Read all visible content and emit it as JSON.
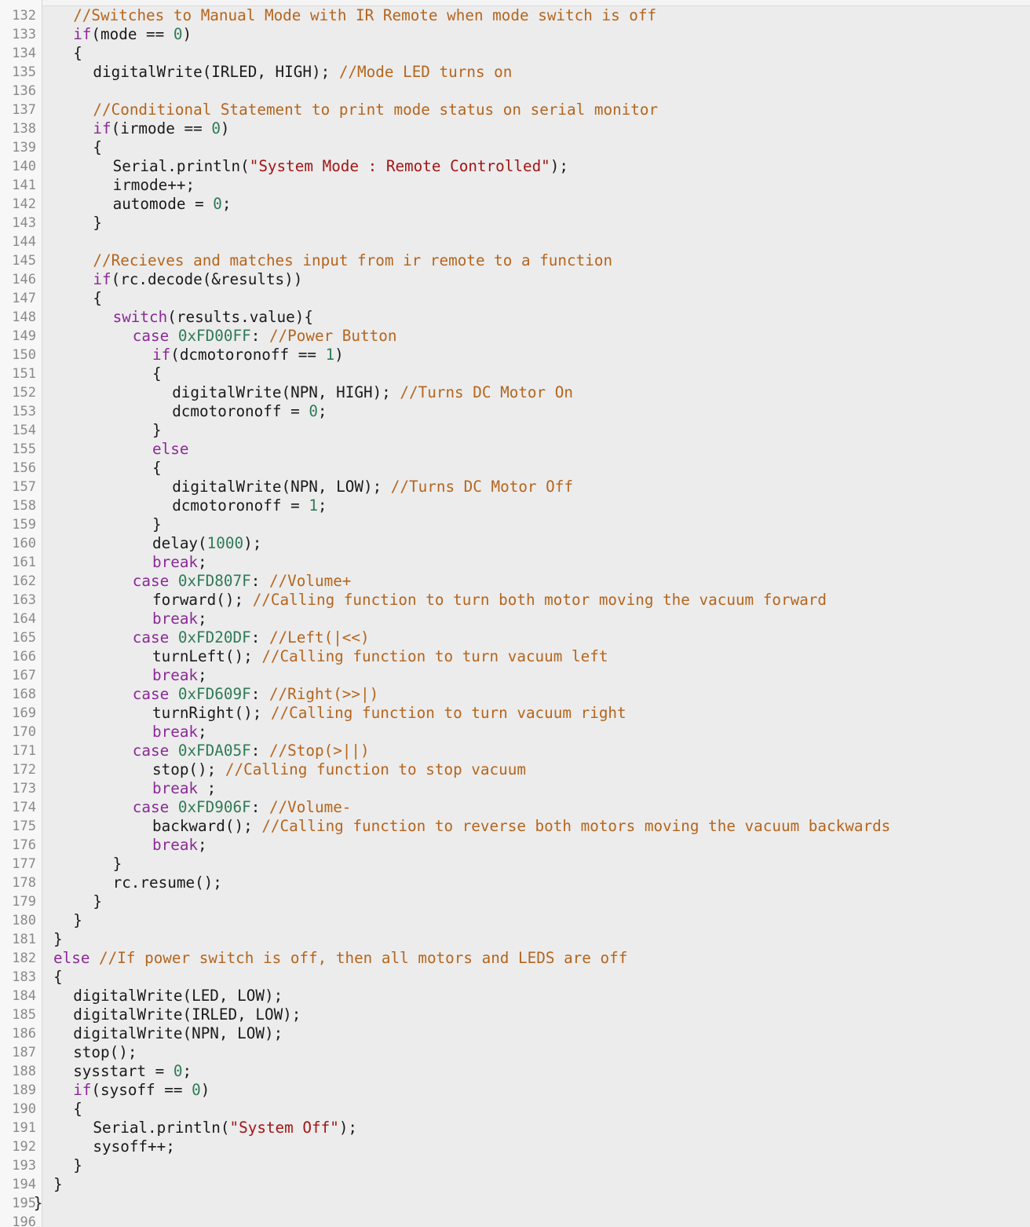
{
  "colors": {
    "background": "#ececec",
    "gutter": "#f7f7f7",
    "line_number": "#8a8a8a",
    "text": "#1a1a1a",
    "keyword": "#8a2a96",
    "comment": "#b5651d",
    "string": "#a31515",
    "number": "#2f7a56"
  },
  "lines": [
    {
      "n": "132",
      "indent": 2,
      "tokens": [
        {
          "t": "cm",
          "v": "//Switches to Manual Mode with IR Remote when mode switch is off"
        }
      ]
    },
    {
      "n": "133",
      "indent": 2,
      "tokens": [
        {
          "t": "kw",
          "v": "if"
        },
        {
          "t": "tx",
          "v": "(mode == "
        },
        {
          "t": "nm",
          "v": "0"
        },
        {
          "t": "tx",
          "v": ")"
        }
      ]
    },
    {
      "n": "134",
      "indent": 2,
      "tokens": [
        {
          "t": "tx",
          "v": "{"
        }
      ]
    },
    {
      "n": "135",
      "indent": 3,
      "tokens": [
        {
          "t": "tx",
          "v": "digitalWrite(IRLED, HIGH); "
        },
        {
          "t": "cm",
          "v": "//Mode LED turns on"
        }
      ]
    },
    {
      "n": "136",
      "indent": 0,
      "tokens": []
    },
    {
      "n": "137",
      "indent": 3,
      "tokens": [
        {
          "t": "cm",
          "v": "//Conditional Statement to print mode status on serial monitor"
        }
      ]
    },
    {
      "n": "138",
      "indent": 3,
      "tokens": [
        {
          "t": "kw",
          "v": "if"
        },
        {
          "t": "tx",
          "v": "(irmode == "
        },
        {
          "t": "nm",
          "v": "0"
        },
        {
          "t": "tx",
          "v": ")"
        }
      ]
    },
    {
      "n": "139",
      "indent": 3,
      "tokens": [
        {
          "t": "tx",
          "v": "{"
        }
      ]
    },
    {
      "n": "140",
      "indent": 4,
      "tokens": [
        {
          "t": "tx",
          "v": "Serial.println("
        },
        {
          "t": "st",
          "v": "\"System Mode : Remote Controlled\""
        },
        {
          "t": "tx",
          "v": ");"
        }
      ]
    },
    {
      "n": "141",
      "indent": 4,
      "tokens": [
        {
          "t": "tx",
          "v": "irmode++;"
        }
      ]
    },
    {
      "n": "142",
      "indent": 4,
      "tokens": [
        {
          "t": "tx",
          "v": "automode = "
        },
        {
          "t": "nm",
          "v": "0"
        },
        {
          "t": "tx",
          "v": ";"
        }
      ]
    },
    {
      "n": "143",
      "indent": 3,
      "tokens": [
        {
          "t": "tx",
          "v": "}"
        }
      ]
    },
    {
      "n": "144",
      "indent": 0,
      "tokens": []
    },
    {
      "n": "145",
      "indent": 3,
      "tokens": [
        {
          "t": "cm",
          "v": "//Recieves and matches input from ir remote to a function"
        }
      ]
    },
    {
      "n": "146",
      "indent": 3,
      "tokens": [
        {
          "t": "kw",
          "v": "if"
        },
        {
          "t": "tx",
          "v": "(rc.decode(&results))"
        }
      ]
    },
    {
      "n": "147",
      "indent": 3,
      "tokens": [
        {
          "t": "tx",
          "v": "{"
        }
      ]
    },
    {
      "n": "148",
      "indent": 4,
      "tokens": [
        {
          "t": "kw",
          "v": "switch"
        },
        {
          "t": "tx",
          "v": "(results.value){"
        }
      ]
    },
    {
      "n": "149",
      "indent": 5,
      "tokens": [
        {
          "t": "kw",
          "v": "case"
        },
        {
          "t": "tx",
          "v": " "
        },
        {
          "t": "nm",
          "v": "0xFD00FF"
        },
        {
          "t": "tx",
          "v": ": "
        },
        {
          "t": "cm",
          "v": "//Power Button"
        }
      ]
    },
    {
      "n": "150",
      "indent": 6,
      "tokens": [
        {
          "t": "kw",
          "v": "if"
        },
        {
          "t": "tx",
          "v": "(dcmotoronoff == "
        },
        {
          "t": "nm",
          "v": "1"
        },
        {
          "t": "tx",
          "v": ")"
        }
      ]
    },
    {
      "n": "151",
      "indent": 6,
      "tokens": [
        {
          "t": "tx",
          "v": "{"
        }
      ]
    },
    {
      "n": "152",
      "indent": 7,
      "tokens": [
        {
          "t": "tx",
          "v": "digitalWrite(NPN, HIGH); "
        },
        {
          "t": "cm",
          "v": "//Turns DC Motor On"
        }
      ]
    },
    {
      "n": "153",
      "indent": 7,
      "tokens": [
        {
          "t": "tx",
          "v": "dcmotoronoff = "
        },
        {
          "t": "nm",
          "v": "0"
        },
        {
          "t": "tx",
          "v": ";"
        }
      ]
    },
    {
      "n": "154",
      "indent": 6,
      "tokens": [
        {
          "t": "tx",
          "v": "}"
        }
      ]
    },
    {
      "n": "155",
      "indent": 6,
      "tokens": [
        {
          "t": "kw",
          "v": "else"
        }
      ]
    },
    {
      "n": "156",
      "indent": 6,
      "tokens": [
        {
          "t": "tx",
          "v": "{"
        }
      ]
    },
    {
      "n": "157",
      "indent": 7,
      "tokens": [
        {
          "t": "tx",
          "v": "digitalWrite(NPN, LOW); "
        },
        {
          "t": "cm",
          "v": "//Turns DC Motor Off"
        }
      ]
    },
    {
      "n": "158",
      "indent": 7,
      "tokens": [
        {
          "t": "tx",
          "v": "dcmotoronoff = "
        },
        {
          "t": "nm",
          "v": "1"
        },
        {
          "t": "tx",
          "v": ";"
        }
      ]
    },
    {
      "n": "159",
      "indent": 6,
      "tokens": [
        {
          "t": "tx",
          "v": "}"
        }
      ]
    },
    {
      "n": "160",
      "indent": 6,
      "tokens": [
        {
          "t": "tx",
          "v": "delay("
        },
        {
          "t": "nm",
          "v": "1000"
        },
        {
          "t": "tx",
          "v": ");"
        }
      ]
    },
    {
      "n": "161",
      "indent": 6,
      "tokens": [
        {
          "t": "kw",
          "v": "break"
        },
        {
          "t": "tx",
          "v": ";"
        }
      ]
    },
    {
      "n": "162",
      "indent": 5,
      "tokens": [
        {
          "t": "kw",
          "v": "case"
        },
        {
          "t": "tx",
          "v": " "
        },
        {
          "t": "nm",
          "v": "0xFD807F"
        },
        {
          "t": "tx",
          "v": ": "
        },
        {
          "t": "cm",
          "v": "//Volume+"
        }
      ]
    },
    {
      "n": "163",
      "indent": 6,
      "tokens": [
        {
          "t": "tx",
          "v": "forward(); "
        },
        {
          "t": "cm",
          "v": "//Calling function to turn both motor moving the vacuum forward"
        }
      ]
    },
    {
      "n": "164",
      "indent": 6,
      "tokens": [
        {
          "t": "kw",
          "v": "break"
        },
        {
          "t": "tx",
          "v": ";"
        }
      ]
    },
    {
      "n": "165",
      "indent": 5,
      "tokens": [
        {
          "t": "kw",
          "v": "case"
        },
        {
          "t": "tx",
          "v": " "
        },
        {
          "t": "nm",
          "v": "0xFD20DF"
        },
        {
          "t": "tx",
          "v": ": "
        },
        {
          "t": "cm",
          "v": "//Left(|<<)"
        }
      ]
    },
    {
      "n": "166",
      "indent": 6,
      "tokens": [
        {
          "t": "tx",
          "v": "turnLeft(); "
        },
        {
          "t": "cm",
          "v": "//Calling function to turn vacuum left"
        }
      ]
    },
    {
      "n": "167",
      "indent": 6,
      "tokens": [
        {
          "t": "kw",
          "v": "break"
        },
        {
          "t": "tx",
          "v": ";"
        }
      ]
    },
    {
      "n": "168",
      "indent": 5,
      "tokens": [
        {
          "t": "kw",
          "v": "case"
        },
        {
          "t": "tx",
          "v": " "
        },
        {
          "t": "nm",
          "v": "0xFD609F"
        },
        {
          "t": "tx",
          "v": ": "
        },
        {
          "t": "cm",
          "v": "//Right(>>|)"
        }
      ]
    },
    {
      "n": "169",
      "indent": 6,
      "tokens": [
        {
          "t": "tx",
          "v": "turnRight(); "
        },
        {
          "t": "cm",
          "v": "//Calling function to turn vacuum right"
        }
      ]
    },
    {
      "n": "170",
      "indent": 6,
      "tokens": [
        {
          "t": "kw",
          "v": "break"
        },
        {
          "t": "tx",
          "v": ";"
        }
      ]
    },
    {
      "n": "171",
      "indent": 5,
      "tokens": [
        {
          "t": "kw",
          "v": "case"
        },
        {
          "t": "tx",
          "v": " "
        },
        {
          "t": "nm",
          "v": "0xFDA05F"
        },
        {
          "t": "tx",
          "v": ": "
        },
        {
          "t": "cm",
          "v": "//Stop(>||)"
        }
      ]
    },
    {
      "n": "172",
      "indent": 6,
      "tokens": [
        {
          "t": "tx",
          "v": "stop(); "
        },
        {
          "t": "cm",
          "v": "//Calling function to stop vacuum"
        }
      ]
    },
    {
      "n": "173",
      "indent": 6,
      "tokens": [
        {
          "t": "kw",
          "v": "break"
        },
        {
          "t": "tx",
          "v": " ;"
        }
      ]
    },
    {
      "n": "174",
      "indent": 5,
      "tokens": [
        {
          "t": "kw",
          "v": "case"
        },
        {
          "t": "tx",
          "v": " "
        },
        {
          "t": "nm",
          "v": "0xFD906F"
        },
        {
          "t": "tx",
          "v": ": "
        },
        {
          "t": "cm",
          "v": "//Volume-"
        }
      ]
    },
    {
      "n": "175",
      "indent": 6,
      "tokens": [
        {
          "t": "tx",
          "v": "backward(); "
        },
        {
          "t": "cm",
          "v": "//Calling function to reverse both motors moving the vacuum backwards"
        }
      ]
    },
    {
      "n": "176",
      "indent": 6,
      "tokens": [
        {
          "t": "kw",
          "v": "break"
        },
        {
          "t": "tx",
          "v": ";"
        }
      ]
    },
    {
      "n": "177",
      "indent": 4,
      "tokens": [
        {
          "t": "tx",
          "v": "}"
        }
      ]
    },
    {
      "n": "178",
      "indent": 4,
      "tokens": [
        {
          "t": "tx",
          "v": "rc.resume();"
        }
      ]
    },
    {
      "n": "179",
      "indent": 3,
      "tokens": [
        {
          "t": "tx",
          "v": "}"
        }
      ]
    },
    {
      "n": "180",
      "indent": 2,
      "tokens": [
        {
          "t": "tx",
          "v": "}"
        }
      ]
    },
    {
      "n": "181",
      "indent": 1,
      "tokens": [
        {
          "t": "tx",
          "v": "}"
        }
      ]
    },
    {
      "n": "182",
      "indent": 1,
      "tokens": [
        {
          "t": "kw",
          "v": "else"
        },
        {
          "t": "tx",
          "v": " "
        },
        {
          "t": "cm",
          "v": "//If power switch is off, then all motors and LEDS are off"
        }
      ]
    },
    {
      "n": "183",
      "indent": 1,
      "tokens": [
        {
          "t": "tx",
          "v": "{"
        }
      ]
    },
    {
      "n": "184",
      "indent": 2,
      "tokens": [
        {
          "t": "tx",
          "v": "digitalWrite(LED, LOW);"
        }
      ]
    },
    {
      "n": "185",
      "indent": 2,
      "tokens": [
        {
          "t": "tx",
          "v": "digitalWrite(IRLED, LOW);"
        }
      ]
    },
    {
      "n": "186",
      "indent": 2,
      "tokens": [
        {
          "t": "tx",
          "v": "digitalWrite(NPN, LOW);"
        }
      ]
    },
    {
      "n": "187",
      "indent": 2,
      "tokens": [
        {
          "t": "tx",
          "v": "stop();"
        }
      ]
    },
    {
      "n": "188",
      "indent": 2,
      "tokens": [
        {
          "t": "tx",
          "v": "sysstart = "
        },
        {
          "t": "nm",
          "v": "0"
        },
        {
          "t": "tx",
          "v": ";"
        }
      ]
    },
    {
      "n": "189",
      "indent": 2,
      "tokens": [
        {
          "t": "kw",
          "v": "if"
        },
        {
          "t": "tx",
          "v": "(sysoff == "
        },
        {
          "t": "nm",
          "v": "0"
        },
        {
          "t": "tx",
          "v": ")"
        }
      ]
    },
    {
      "n": "190",
      "indent": 2,
      "tokens": [
        {
          "t": "tx",
          "v": "{"
        }
      ]
    },
    {
      "n": "191",
      "indent": 3,
      "tokens": [
        {
          "t": "tx",
          "v": "Serial.println("
        },
        {
          "t": "st",
          "v": "\"System Off\""
        },
        {
          "t": "tx",
          "v": ");"
        }
      ]
    },
    {
      "n": "192",
      "indent": 3,
      "tokens": [
        {
          "t": "tx",
          "v": "sysoff++;"
        }
      ]
    },
    {
      "n": "193",
      "indent": 2,
      "tokens": [
        {
          "t": "tx",
          "v": "}"
        }
      ]
    },
    {
      "n": "194",
      "indent": 1,
      "tokens": [
        {
          "t": "tx",
          "v": "}"
        }
      ]
    },
    {
      "n": "195",
      "indent": 0,
      "tokens": [
        {
          "t": "tx",
          "v": "}"
        }
      ]
    },
    {
      "n": "196",
      "indent": 0,
      "tokens": []
    }
  ]
}
